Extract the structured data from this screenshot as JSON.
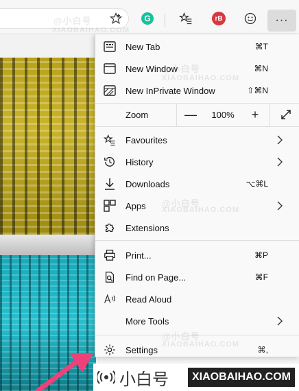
{
  "toolbar": {
    "icons": [
      "star-outline-icon",
      "grammarly-icon",
      "favorites-icon",
      "rb-extension-icon",
      "emoji-icon",
      "more-icon"
    ],
    "grammarly_letter": "G",
    "rb_text": "rB",
    "more_label": "···"
  },
  "menu": {
    "items": [
      {
        "label": "New Tab",
        "shortcut": "⌘T",
        "icon": "new-tab-icon"
      },
      {
        "label": "New Window",
        "shortcut": "⌘N",
        "icon": "window-icon"
      },
      {
        "label": "New InPrivate Window",
        "shortcut": "⇧⌘N",
        "icon": "inprivate-icon"
      }
    ],
    "zoom": {
      "label": "Zoom",
      "minus": "—",
      "value": "100%",
      "plus": "+"
    },
    "items2": [
      {
        "label": "Favourites",
        "icon": "favourites-icon"
      },
      {
        "label": "History",
        "icon": "history-icon"
      },
      {
        "label": "Downloads",
        "shortcut": "⌥⌘L",
        "icon": "download-icon"
      },
      {
        "label": "Apps",
        "icon": "apps-icon"
      },
      {
        "label": "Extensions",
        "icon": "puzzle-icon"
      }
    ],
    "items3": [
      {
        "label": "Print...",
        "shortcut": "⌘P",
        "icon": "print-icon"
      },
      {
        "label": "Find on Page...",
        "shortcut": "⌘F",
        "icon": "find-icon"
      },
      {
        "label": "Read Aloud",
        "icon": "read-aloud-icon"
      },
      {
        "label": "More Tools",
        "icon": ""
      }
    ],
    "items4": [
      {
        "label": "Settings",
        "shortcut": "⌘,",
        "icon": "settings-icon"
      }
    ]
  },
  "watermark": {
    "cn": "@小白号",
    "en": "XIAOBAIHAO.COM"
  },
  "banner": {
    "cn": "小白号",
    "en": "XIAOBAIHAO.COM"
  },
  "colors": {
    "arrow": "#f0407a",
    "grammarly": "#15c39a",
    "rb": "#d9363e"
  }
}
